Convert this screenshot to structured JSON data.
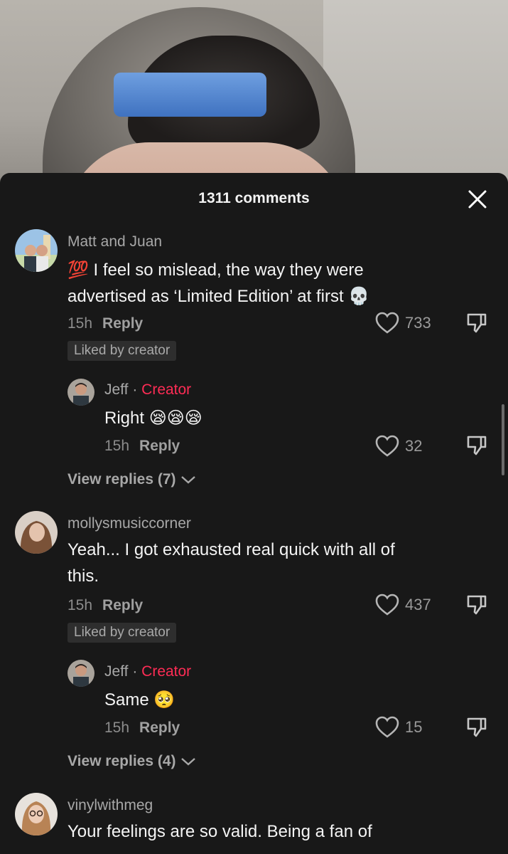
{
  "header": {
    "title": "1311 comments"
  },
  "comments": [
    {
      "username": "Matt and Juan",
      "text": "💯 I feel so mislead, the way they were advertised as ‘Limited Edition’ at first 💀",
      "text_line1": "💯 I feel so mislead, the way they were",
      "text_line2": "advertised as ‘Limited Edition’ at first 💀",
      "time": "15h",
      "reply_label": "Reply",
      "likes": "733",
      "badge": "Liked by creator",
      "reply": {
        "username": "Jeff",
        "separator": "·",
        "tag": "Creator",
        "text": "Right 😪😪😪",
        "time": "15h",
        "reply_label": "Reply",
        "likes": "32"
      },
      "view_replies": "View replies (7)"
    },
    {
      "username": "mollysmusiccorner",
      "text_line1": "Yeah... I got exhausted real quick with all of",
      "text_line2": "this.",
      "time": "15h",
      "reply_label": "Reply",
      "likes": "437",
      "badge": "Liked by creator",
      "reply": {
        "username": "Jeff",
        "separator": "·",
        "tag": "Creator",
        "text": "Same 🥺",
        "time": "15h",
        "reply_label": "Reply",
        "likes": "15"
      },
      "view_replies": "View replies (4)"
    },
    {
      "username": "vinylwithmeg",
      "text_line1": "Your feelings are so valid. Being a fan of"
    }
  ],
  "colors": {
    "accent": "#fe2c55",
    "sheet_bg": "#181818",
    "text": "#f4f4f4",
    "muted": "#a8a8a8"
  }
}
